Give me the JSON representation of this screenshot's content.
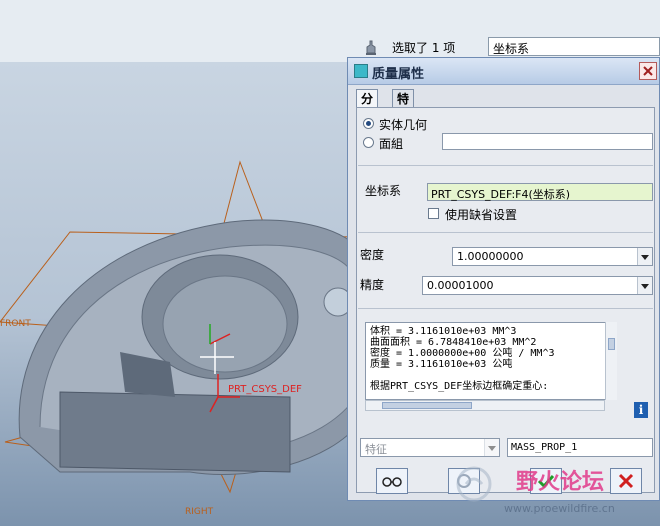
{
  "topbar": {
    "selection_text": "选取了 1 项",
    "filter_value": "坐标系"
  },
  "viewport": {
    "datum_front": "FRONT",
    "datum_right": "RIGHT",
    "csys_label": "PRT_CSYS_DEF"
  },
  "dialog": {
    "title": "质量属性",
    "tabs": [
      "分析",
      "特征"
    ],
    "geometry_solid": "实体几何",
    "geometry_quilt": "面組",
    "quilt_value": "",
    "csys_label": "坐标系",
    "csys_value": "PRT_CSYS_DEF:F4(坐标系)",
    "use_default_label": "使用缺省设置",
    "density_label": "密度",
    "density_value": "1.00000000",
    "accuracy_label": "精度",
    "accuracy_value": "0.00001000",
    "results": [
      "体积 =  3.1161010e+03  MM^3",
      "曲面面积 =  6.7848410e+03  MM^2",
      "密度 =  1.0000000e+00 公吨 / MM^3",
      "质量 =  3.1161010e+03 公吨",
      "",
      "根据PRT_CSYS_DEF坐标边框确定重心:"
    ],
    "info_glyph": "i",
    "feature_placeholder": "特征",
    "feature_name": "MASS_PROP_1"
  },
  "watermark": {
    "text": "野火论坛",
    "url": "www.proewildfire.cn"
  },
  "colors": {
    "accent": "#244a80",
    "csys_field_bg": "#e6f5cf",
    "part_body": "#8c98a8",
    "datum_plane": "#b9601c"
  }
}
